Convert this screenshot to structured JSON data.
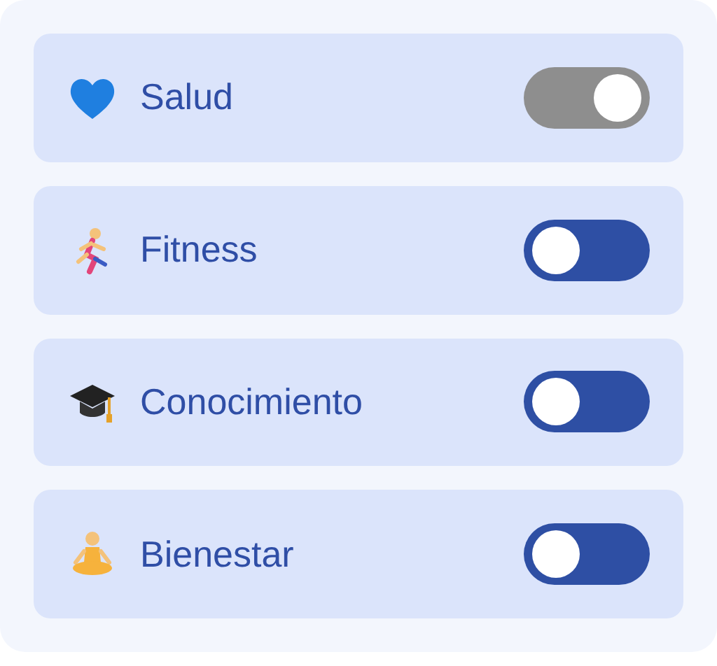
{
  "settings": [
    {
      "label": "Salud",
      "on": true
    },
    {
      "label": "Fitness",
      "on": false
    },
    {
      "label": "Conocimiento",
      "on": false
    },
    {
      "label": "Bienestar",
      "on": false
    }
  ]
}
